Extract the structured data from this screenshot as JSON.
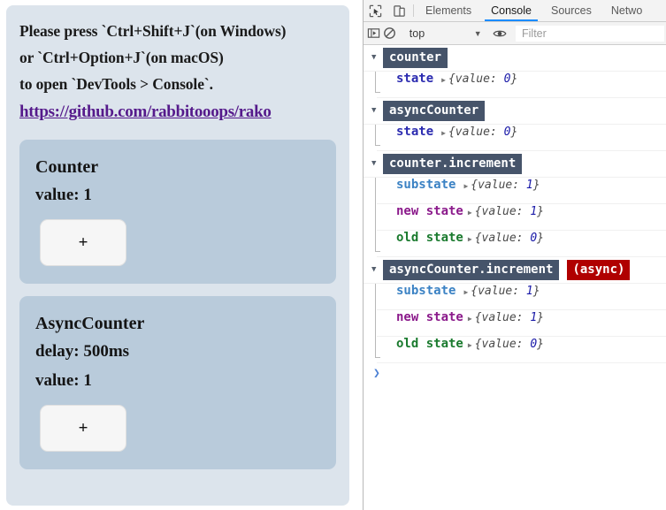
{
  "page": {
    "instructions": [
      "Please press `Ctrl+Shift+J`(on Windows)",
      "or `Ctrl+Option+J`(on macOS)",
      "to open `DevTools > Console`."
    ],
    "repo_link": "https://github.com/rabbitooops/rako",
    "counters": [
      {
        "title": "Counter",
        "rows": [
          "value: 1"
        ],
        "button_label": "+"
      },
      {
        "title": "AsyncCounter",
        "rows": [
          "delay: 500ms",
          "value: 1"
        ],
        "button_label": "+"
      }
    ],
    "colors": {
      "panel_bg": "#dce4ec",
      "card_bg": "#b9cbdb",
      "link": "#551a8b"
    }
  },
  "devtools": {
    "tabs": [
      {
        "label": "Elements",
        "active": false
      },
      {
        "label": "Console",
        "active": true
      },
      {
        "label": "Sources",
        "active": false
      },
      {
        "label": "Netwo",
        "active": false
      }
    ],
    "tab_icons": [
      "inspect-element-icon",
      "device-toolbar-icon"
    ],
    "toolbar": {
      "sidebar_toggle_icon": "console-sidebar-icon",
      "clear_icon": "clear-console-icon",
      "context_value": "top",
      "caret": "▼",
      "eye_icon": "live-expression-eye-icon",
      "filter_placeholder": "Filter"
    },
    "accent_color": "#1a8cff",
    "console": {
      "groups": [
        {
          "label": "counter",
          "badge": null,
          "triangle": "▼",
          "rows": [
            {
              "key": "state",
              "key_class": "k-state",
              "value": "{value: ",
              "num": "0",
              "value_end": "}"
            }
          ]
        },
        {
          "label": "asyncCounter",
          "badge": null,
          "triangle": "▼",
          "rows": [
            {
              "key": "state",
              "key_class": "k-state",
              "value": "{value: ",
              "num": "0",
              "value_end": "}"
            }
          ]
        },
        {
          "label": "counter.increment",
          "badge": null,
          "triangle": "▼",
          "rows": [
            {
              "key": "substate",
              "key_class": "k-sub",
              "value": "{value: ",
              "num": "1",
              "value_end": "}"
            },
            {
              "key": "new state",
              "key_class": "k-new",
              "value": "{value: ",
              "num": "1",
              "value_end": "}"
            },
            {
              "key": "old state",
              "key_class": "k-old",
              "value": "{value: ",
              "num": "0",
              "value_end": "}"
            }
          ]
        },
        {
          "label": "asyncCounter.increment",
          "badge": "(async)",
          "triangle": "▼",
          "rows": [
            {
              "key": "substate",
              "key_class": "k-sub",
              "value": "{value: ",
              "num": "1",
              "value_end": "}"
            },
            {
              "key": "new state",
              "key_class": "k-new",
              "value": "{value: ",
              "num": "1",
              "value_end": "}"
            },
            {
              "key": "old state",
              "key_class": "k-old",
              "value": "{value: ",
              "num": "0",
              "value_end": "}"
            }
          ]
        }
      ],
      "prompt_caret": "❯",
      "group_label_bg": "#46546a",
      "async_badge_bg": "#b00000",
      "expander_glyph": "▶"
    }
  }
}
